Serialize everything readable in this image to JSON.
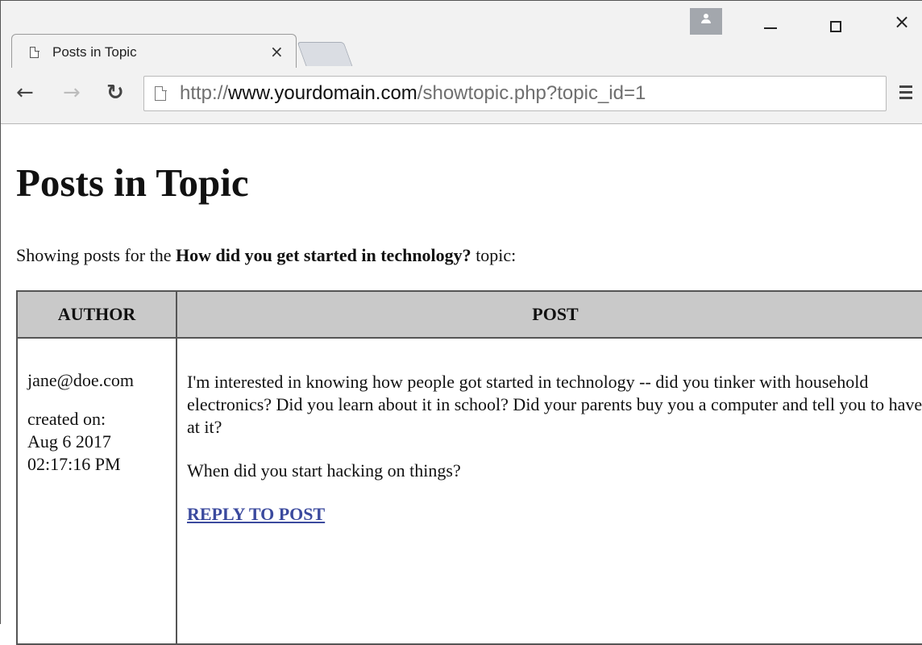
{
  "browser": {
    "tab_title": "Posts in Topic",
    "tab_close": "×",
    "close_glyph": "×",
    "url_prefix": "http://",
    "url_host": "www.yourdomain.com",
    "url_path": "/showtopic.php?topic_id=1"
  },
  "page": {
    "title": "Posts in Topic",
    "intro_prefix": "Showing posts for the ",
    "topic_title": "How did you get started in technology?",
    "intro_suffix": " topic:"
  },
  "table": {
    "headers": [
      "AUTHOR",
      "POST"
    ],
    "rows": [
      {
        "author": "jane@doe.com",
        "created_label": "created on:",
        "created_date": "Aug 6 2017",
        "created_time": "02:17:16 PM",
        "post_paragraphs": [
          "I'm interested in knowing how people got started in technology -- did you tinker with household electronics? Did you learn about it in school? Did your parents buy you a computer and tell you to have at it?",
          "When did you start hacking on things?"
        ],
        "reply_label": "REPLY TO POST"
      }
    ]
  },
  "colors": {
    "link": "#3b4a9e",
    "table_header_bg": "#c9c9c9"
  },
  "icons": [
    "page-icon",
    "back-arrow-icon",
    "forward-arrow-icon",
    "reload-icon",
    "menu-icon",
    "profile-icon"
  ]
}
